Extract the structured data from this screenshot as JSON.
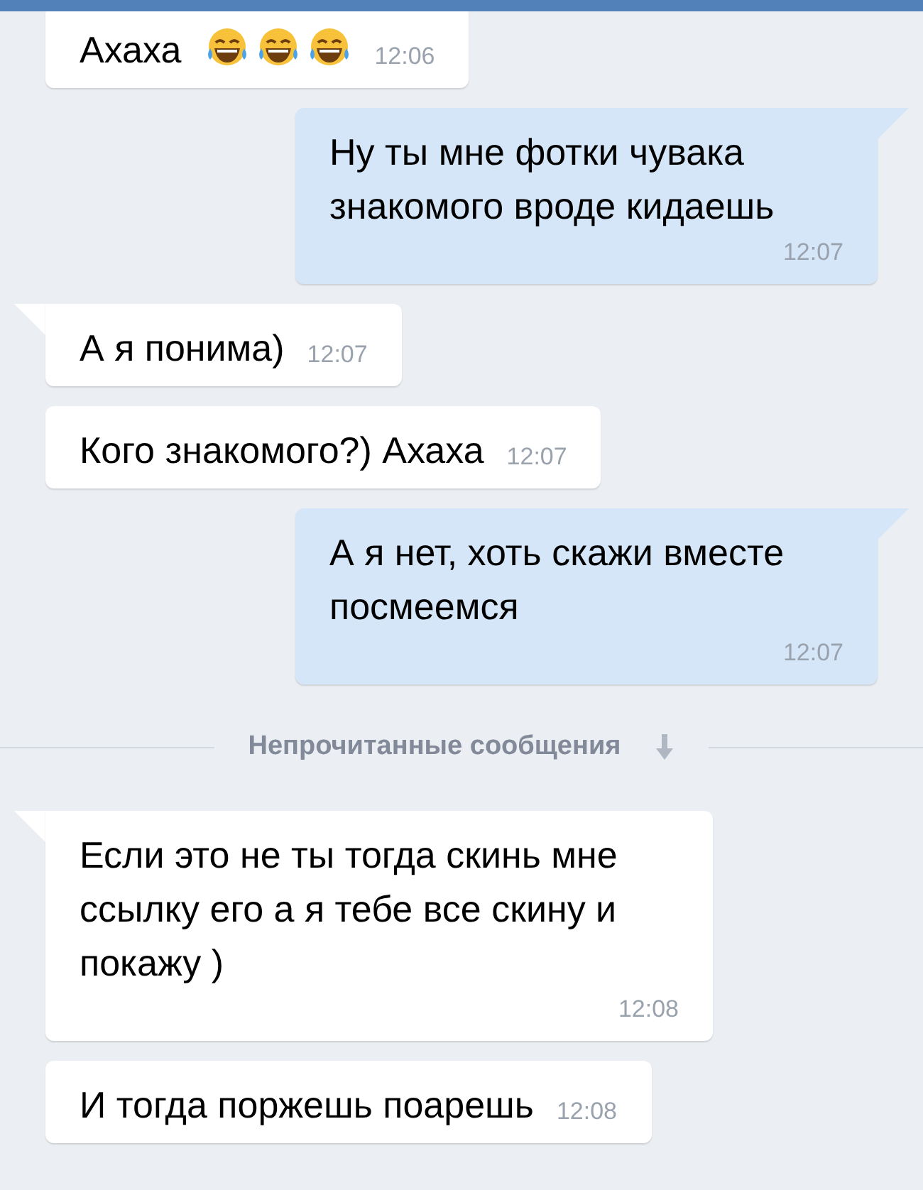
{
  "messages": [
    {
      "kind": "incoming",
      "tail": false,
      "text": "Ахаха",
      "emojis": [
        {
          "kind": "laughing"
        },
        {
          "kind": "laughing"
        },
        {
          "kind": "laughing"
        }
      ],
      "time": "12:06"
    },
    {
      "kind": "outgoing",
      "tail": true,
      "text": "Ну ты мне фотки чувака знакомого вроде кидаешь",
      "time": "12:07"
    },
    {
      "kind": "incoming",
      "tail": true,
      "text": "А я понима)",
      "time": "12:07"
    },
    {
      "kind": "incoming",
      "tail": false,
      "text": "Кого знакомого?) Ахаха",
      "time": "12:07"
    },
    {
      "kind": "outgoing",
      "tail": true,
      "text": "А я нет, хоть скажи вместе посмеемся",
      "time": "12:07"
    },
    {
      "kind": "divider",
      "text": "Непрочитанные сообщения"
    },
    {
      "kind": "incoming",
      "tail": true,
      "text": "Если это не ты тогда скинь мне ссылку его а я тебе все скину и покажу )",
      "time": "12:08"
    },
    {
      "kind": "incoming",
      "tail": false,
      "text": "И тогда поржешь поарешь",
      "time": "12:08"
    }
  ]
}
